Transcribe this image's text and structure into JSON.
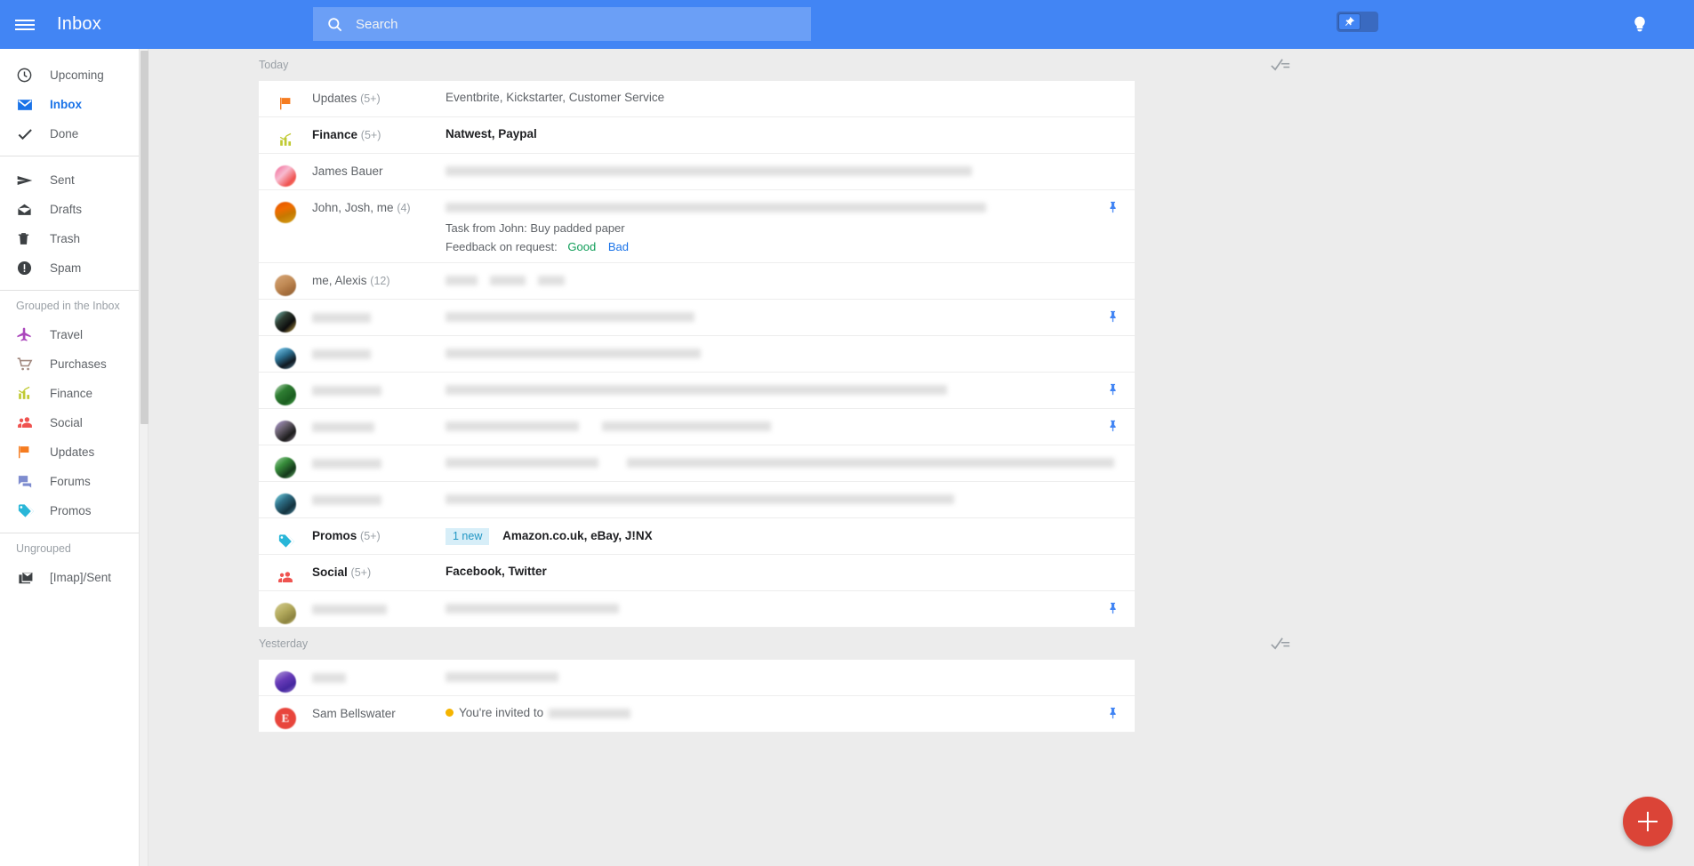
{
  "topbar": {
    "title": "Inbox",
    "menu_icon": "hamburger-icon",
    "search": {
      "placeholder": "Search",
      "value": "",
      "icon": "search-icon"
    },
    "pin_toggle": {
      "icon": "pin-icon",
      "state": "off"
    },
    "bulb_icon": "lightbulb-icon",
    "bg_color": "#4285f4"
  },
  "sidebar": {
    "primary": [
      {
        "label": "Upcoming",
        "icon": "clock-icon",
        "active": false
      },
      {
        "label": "Inbox",
        "icon": "inbox-envelope-icon",
        "active": true
      },
      {
        "label": "Done",
        "icon": "check-icon",
        "active": false
      }
    ],
    "secondary": [
      {
        "label": "Sent",
        "icon": "send-icon"
      },
      {
        "label": "Drafts",
        "icon": "drafts-envelope-icon"
      },
      {
        "label": "Trash",
        "icon": "trash-icon"
      },
      {
        "label": "Spam",
        "icon": "spam-exclamation-icon"
      }
    ],
    "grouped_header": "Grouped in the Inbox",
    "grouped": [
      {
        "label": "Travel",
        "icon": "airplane-icon",
        "color": "#ab47bc"
      },
      {
        "label": "Purchases",
        "icon": "shopping-cart-icon",
        "color": "#a1887f"
      },
      {
        "label": "Finance",
        "icon": "bar-chart-icon",
        "color": "#c0ca33"
      },
      {
        "label": "Social",
        "icon": "people-icon",
        "color": "#ef5350"
      },
      {
        "label": "Updates",
        "icon": "flag-icon",
        "color": "#f57c20"
      },
      {
        "label": "Forums",
        "icon": "forum-bubbles-icon",
        "color": "#7e8ccf"
      },
      {
        "label": "Promos",
        "icon": "tag-icon",
        "color": "#29b6d8"
      }
    ],
    "ungrouped_header": "Ungrouped",
    "ungrouped": [
      {
        "label": "[Imap]/Sent",
        "icon": "stacked-envelopes-icon"
      }
    ],
    "rail_icons": [
      {
        "name": "feedback-bubble-icon"
      },
      {
        "name": "exit-running-man-icon"
      }
    ]
  },
  "main": {
    "sections": [
      {
        "title": "Today",
        "sweep_icon": "sweep-check-icon",
        "rows": [
          {
            "kind": "bundle",
            "icon": "flag-icon",
            "icon_color": "#f57c20",
            "sender": "Updates",
            "count": "(5+)",
            "bold": false,
            "snippet": "Eventbrite, Kickstarter, Customer Service",
            "snippet_bold": false,
            "pinned": false
          },
          {
            "kind": "bundle",
            "icon": "bar-chart-icon",
            "icon_color": "#c0ca33",
            "sender": "Finance",
            "count": "(5+)",
            "bold": true,
            "snippet": "Natwest, Paypal",
            "snippet_bold": true,
            "pinned": false
          },
          {
            "kind": "message",
            "avatar": "pink",
            "sender": "James Bauer",
            "count": "",
            "bold": false,
            "snippet_redacted": true,
            "redact_w": 592,
            "pinned": false
          },
          {
            "kind": "message",
            "avatar": "orange",
            "sender": "John, Josh, me",
            "count": "(4)",
            "bold": false,
            "snippet_redacted": true,
            "redact_w": 608,
            "sub": "Task from John: Buy padded paper",
            "feedback_label": "Feedback on request:",
            "feedback_good": "Good",
            "feedback_bad": "Bad",
            "pinned": true,
            "tall": true
          },
          {
            "kind": "message",
            "avatar": "tan",
            "sender": "me, Alexis",
            "count": "(12)",
            "bold": false,
            "snippet_redacted": true,
            "redact_w": 128,
            "pinned": false
          },
          {
            "kind": "message",
            "avatar": "darkolive",
            "sender_redacted": true,
            "sender_w": 66,
            "snippet_redacted": true,
            "redact_w": 280,
            "pinned": true
          },
          {
            "kind": "message",
            "avatar": "blue",
            "sender_redacted": true,
            "sender_w": 66,
            "snippet_redacted": true,
            "redact_w": 287,
            "pinned": false
          },
          {
            "kind": "message",
            "avatar": "green",
            "sender_redacted": true,
            "sender_w": 78,
            "snippet_redacted": true,
            "redact_w": 564,
            "pinned": true
          },
          {
            "kind": "message",
            "avatar": "mauve",
            "sender_redacted": true,
            "sender_w": 70,
            "snippet_redacted": true,
            "redact_w": 357,
            "pinned": true
          },
          {
            "kind": "message",
            "avatar": "green2",
            "sender_redacted": true,
            "sender_w": 78,
            "snippet_redacted": true,
            "redact_w": 745,
            "pinned": false
          },
          {
            "kind": "message",
            "avatar": "teal",
            "sender_redacted": true,
            "sender_w": 78,
            "snippet_redacted": true,
            "redact_w": 572,
            "pinned": false
          },
          {
            "kind": "bundle",
            "icon": "tag-icon",
            "icon_color": "#29b6d8",
            "sender": "Promos",
            "count": "(5+)",
            "bold": true,
            "badge": "1 new",
            "snippet": "Amazon.co.uk, eBay, J!NX",
            "snippet_bold": true,
            "pinned": false
          },
          {
            "kind": "bundle",
            "icon": "people-icon",
            "icon_color": "#ef5350",
            "sender": "Social",
            "count": "(5+)",
            "bold": true,
            "snippet": "Facebook, Twitter",
            "snippet_bold": true,
            "pinned": false
          },
          {
            "kind": "message",
            "avatar": "khaki",
            "sender_redacted": true,
            "sender_w": 84,
            "snippet_redacted": true,
            "redact_w": 195,
            "pinned": true
          }
        ]
      },
      {
        "title": "Yesterday",
        "sweep_icon": "sweep-check-icon",
        "rows": [
          {
            "kind": "message",
            "avatar": "purple",
            "sender_redacted": true,
            "sender_w": 38,
            "snippet_redacted": true,
            "redact_w": 127,
            "pinned": false
          },
          {
            "kind": "message",
            "avatar_letter": "E",
            "avatar_letter_color": "#e8453c",
            "sender": "Sam Bellswater",
            "count": "",
            "event_dot": true,
            "snippet": "You're invited to",
            "snippet_trailing_redacted": true,
            "trailing_w": 92,
            "pinned": true
          }
        ]
      }
    ]
  },
  "fab": {
    "icon": "plus-icon",
    "label": "Compose",
    "color": "#db4437"
  },
  "colors": {
    "accent": "#4285f4",
    "link": "#1a73e8",
    "good": "#0f9d58",
    "badge_bg": "#d7eef8",
    "badge_fg": "#2196c4"
  }
}
